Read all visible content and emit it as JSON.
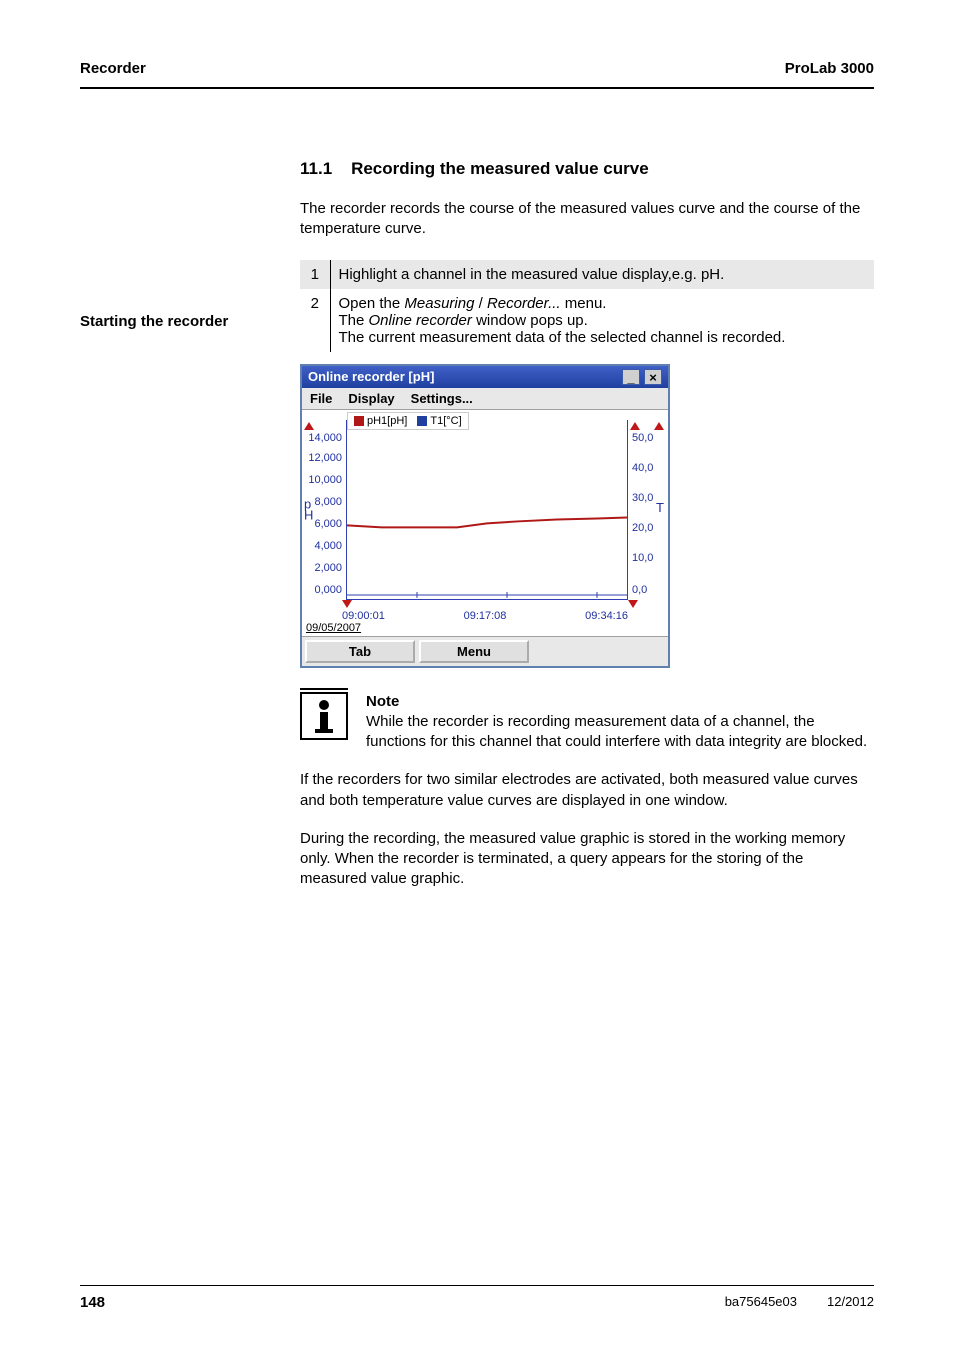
{
  "header": {
    "left": "Recorder",
    "right": "ProLab 3000"
  },
  "section": {
    "number": "11.1",
    "title": "Recording the measured value curve",
    "intro": "The recorder records the course of the measured values curve and the course of the temperature curve."
  },
  "side_label": "Starting the recorder",
  "steps": [
    {
      "num": "1",
      "text": "Highlight a channel in the measured value display,e.g. pH."
    },
    {
      "num": "2",
      "line1_a": "Open the ",
      "line1_b": "Measuring",
      "line1_c": " / ",
      "line1_d": "Recorder...",
      "line1_e": " menu.",
      "line2_a": "The ",
      "line2_b": "Online recorder",
      "line2_c": " window pops up.",
      "line3": "The current measurement data of the selected channel is recorded."
    }
  ],
  "window": {
    "title": "Online recorder [pH]",
    "menus": [
      "File",
      "Display",
      "Settings..."
    ],
    "buttons": [
      "Tab",
      "Menu"
    ],
    "date": "09/05/2007",
    "legend": {
      "s1": "pH1[pH]",
      "s2": "T1[°C]"
    }
  },
  "chart_data": {
    "type": "line",
    "left_axis": {
      "label": "pH",
      "ticks": [
        "14,000",
        "12,000",
        "10,000",
        "8,000",
        "6,000",
        "4,000",
        "2,000",
        "0,000"
      ],
      "ylim": [
        0,
        14
      ]
    },
    "right_axis": {
      "label": "T",
      "ticks": [
        "50,0",
        "40,0",
        "30,0",
        "20,0",
        "10,0",
        "0,0"
      ],
      "ylim": [
        0,
        50
      ]
    },
    "x_ticks": [
      "09:00:01",
      "09:17:08",
      "09:34:16"
    ],
    "series": [
      {
        "name": "pH1[pH]",
        "axis": "left",
        "color": "#b01818",
        "x": [
          "09:00:01",
          "09:08",
          "09:15",
          "09:17:08",
          "09:22",
          "09:30",
          "09:34:16"
        ],
        "values": [
          6.1,
          6.0,
          6.0,
          6.2,
          6.3,
          6.4,
          6.4
        ]
      }
    ]
  },
  "note": {
    "title": "Note",
    "body": "While the recorder is recording measurement data of a channel, the functions for this channel that could interfere with data integrity are blocked."
  },
  "para1": "If the recorders for two similar electrodes are activated, both measured value curves and both temperature value curves are displayed in one window.",
  "para2": "During the recording, the measured value graphic is stored in the working memory only. When the recorder is terminated, a query appears for the storing of the measured value graphic.",
  "footer": {
    "page": "148",
    "doc": "ba75645e03",
    "date": "12/2012"
  }
}
